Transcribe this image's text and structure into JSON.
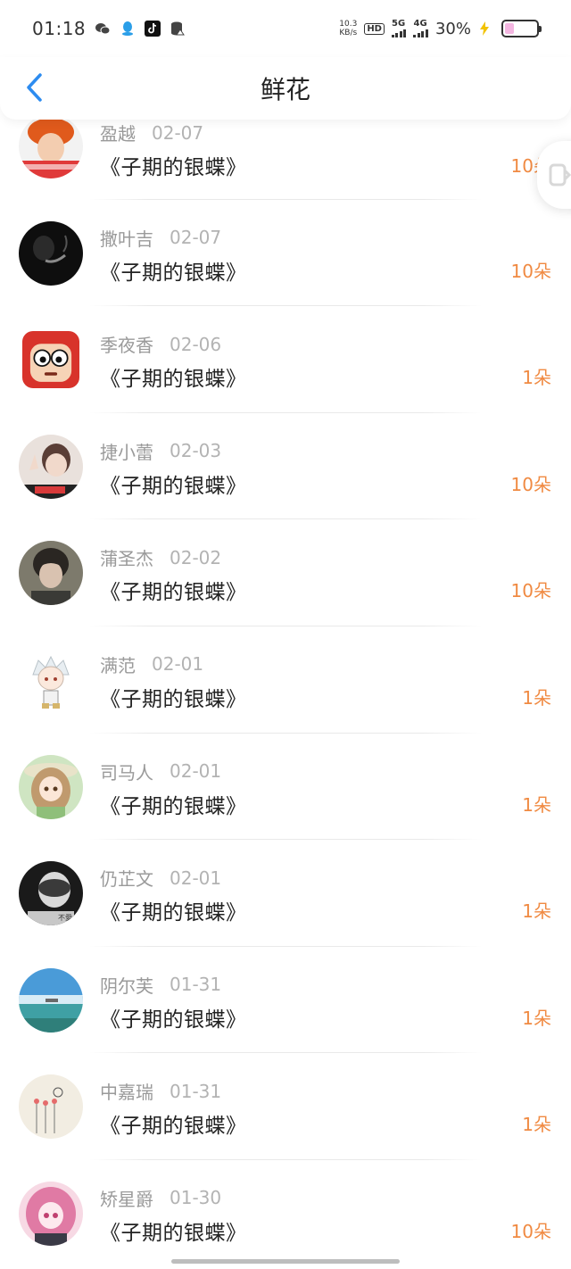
{
  "status_bar": {
    "time": "01:18",
    "net_speed_value": "10.3",
    "net_speed_unit": "KB/s",
    "hd_label": "HD",
    "net_5g": "5G",
    "net_4g": "4G",
    "battery_percent": "30%",
    "icons": [
      "wechat-icon",
      "qq-icon",
      "tiktok-icon",
      "data-icon"
    ]
  },
  "nav": {
    "title": "鲜花",
    "back_icon": "chevron-left-icon"
  },
  "colors": {
    "accent": "#2d8cf0",
    "amount": "#f08a42",
    "name": "#9a9a9a",
    "date": "#b3b3b3"
  },
  "rows": [
    {
      "name": "盈越",
      "date": "02-07",
      "book": "《子期的银蝶》",
      "amount": "10朵",
      "avatar": "avatar-orange-girl"
    },
    {
      "name": "撒叶吉",
      "date": "02-07",
      "book": "《子期的银蝶》",
      "amount": "10朵",
      "avatar": "avatar-dark-smoke"
    },
    {
      "name": "季夜香",
      "date": "02-06",
      "book": "《子期的银蝶》",
      "amount": "1朵",
      "avatar": "avatar-cartoon-face"
    },
    {
      "name": "捷小蕾",
      "date": "02-03",
      "book": "《子期的银蝶》",
      "amount": "10朵",
      "avatar": "avatar-boy-peace"
    },
    {
      "name": "蒲圣杰",
      "date": "02-02",
      "book": "《子期的银蝶》",
      "amount": "10朵",
      "avatar": "avatar-dark-hair-boy"
    },
    {
      "name": "满范",
      "date": "02-01",
      "book": "《子期的银蝶》",
      "amount": "1朵",
      "avatar": "avatar-white-hair-chibi"
    },
    {
      "name": "司马人",
      "date": "02-01",
      "book": "《子期的银蝶》",
      "amount": "1朵",
      "avatar": "avatar-anime-girl-hat"
    },
    {
      "name": "仍芷文",
      "date": "02-01",
      "book": "《子期的银蝶》",
      "amount": "1朵",
      "avatar": "avatar-bw-portrait"
    },
    {
      "name": "阴尔芙",
      "date": "01-31",
      "book": "《子期的银蝶》",
      "amount": "1朵",
      "avatar": "avatar-sea-landscape"
    },
    {
      "name": "中嘉瑞",
      "date": "01-31",
      "book": "《子期的银蝶》",
      "amount": "1朵",
      "avatar": "avatar-sketch-flowers"
    },
    {
      "name": "矫星爵",
      "date": "01-30",
      "book": "《子期的银蝶》",
      "amount": "10朵",
      "avatar": "avatar-pink-anime-girl"
    }
  ]
}
